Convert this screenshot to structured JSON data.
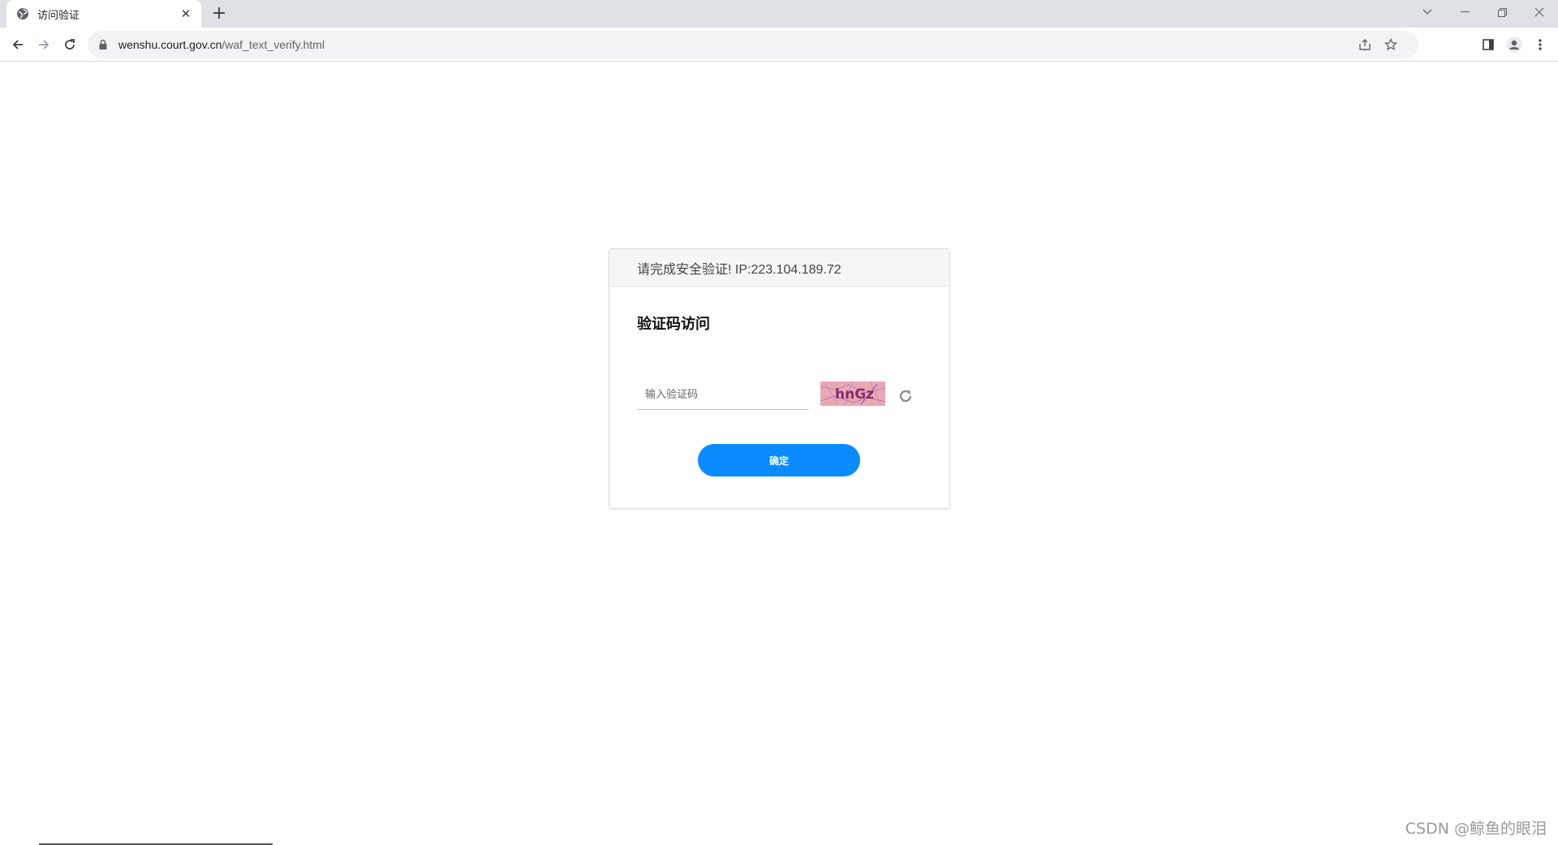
{
  "browser": {
    "tab": {
      "title": "访问验证",
      "favicon": "globe-icon",
      "close_symbol": "✕"
    },
    "new_tab_symbol": "+",
    "address": {
      "host": "wenshu.court.gov.cn",
      "path": "/waf_text_verify.html"
    },
    "icons": [
      "back-icon",
      "forward-icon",
      "reload-icon",
      "lock-icon",
      "share-icon",
      "star-icon",
      "side-panel-icon",
      "profile-icon",
      "menu-icon"
    ]
  },
  "card": {
    "header": "请完成安全验证!  IP:223.104.189.72",
    "title": "验证码访问",
    "input_placeholder": "输入验证码",
    "captcha_text": "hnGz",
    "submit_label": "确定"
  },
  "watermark": "CSDN @鲸鱼的眼泪",
  "colors": {
    "accent": "#0a8cff",
    "captcha_bg": "#e9a8b3",
    "captcha_text": "#8a2a6e"
  }
}
